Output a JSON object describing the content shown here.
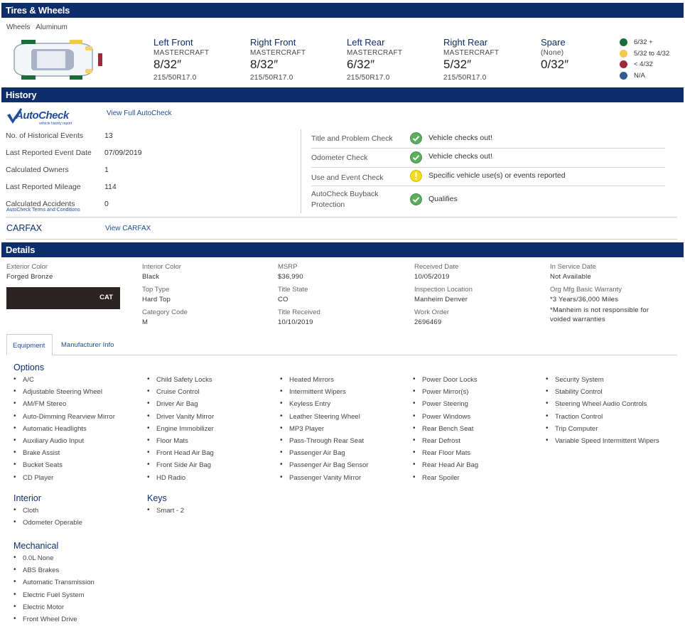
{
  "tires": {
    "header": "Tires & Wheels",
    "wheels_label": "Wheels",
    "wheels_value": "Aluminum",
    "positions": [
      {
        "name": "Left Front",
        "brand": "MASTERCRAFT",
        "depth": "8/32″",
        "size": "215/50R17.0"
      },
      {
        "name": "Right Front",
        "brand": "MASTERCRAFT",
        "depth": "8/32″",
        "size": "215/50R17.0"
      },
      {
        "name": "Left Rear",
        "brand": "MASTERCRAFT",
        "depth": "6/32″",
        "size": "215/50R17.0"
      },
      {
        "name": "Right Rear",
        "brand": "MASTERCRAFT",
        "depth": "5/32″",
        "size": "215/50R17.0"
      },
      {
        "name": "Spare",
        "brand": "(None)",
        "depth": "0/32″",
        "size": ""
      }
    ],
    "legend": [
      {
        "label": "6/32 +",
        "color": "#1c6b3a"
      },
      {
        "label": "5/32 to 4/32",
        "color": "#f2c94c"
      },
      {
        "label": "< 4/32",
        "color": "#9e2a3d"
      },
      {
        "label": "N/A",
        "color": "#2e5d91"
      }
    ]
  },
  "history": {
    "header": "History",
    "autocheck_logo_text": "AutoCheck",
    "autocheck_logo_sub": "vehicle history report",
    "view_autocheck": "View Full AutoCheck",
    "rows": [
      {
        "label": "No. of Historical Events",
        "value": "13"
      },
      {
        "label": "Last Reported Event Date",
        "value": "07/09/2019"
      },
      {
        "label": "Calculated Owners",
        "value": "1"
      },
      {
        "label": "Last Reported Mileage",
        "value": "114"
      },
      {
        "label": "Calculated Accidents",
        "value": "0"
      }
    ],
    "terms_link": "AutoCheck Terms and Conditions",
    "checks": [
      {
        "label": "Title and Problem Check",
        "result": "Vehicle checks out!",
        "status": "ok"
      },
      {
        "label": "Odometer Check",
        "result": "Vehicle checks out!",
        "status": "ok"
      },
      {
        "label": "Use and Event Check",
        "result": "Specific vehicle use(s) or events reported",
        "status": "warn"
      },
      {
        "label": "AutoCheck Buyback Protection",
        "result": "Qualifies",
        "status": "ok"
      }
    ],
    "carfax_label": "CARFAX",
    "view_carfax": "View CARFAX"
  },
  "details": {
    "header": "Details",
    "exterior_color_label": "Exterior Color",
    "exterior_color_value": "Forged Bronze",
    "swatch_text": "CAT",
    "interior_color_label": "Interior Color",
    "interior_color_value": "Black",
    "top_type_label": "Top Type",
    "top_type_value": "Hard Top",
    "category_code_label": "Category Code",
    "category_code_value": "M",
    "msrp_label": "MSRP",
    "msrp_value": "$36,990",
    "title_state_label": "Title State",
    "title_state_value": "CO",
    "title_received_label": "Title Received",
    "title_received_value": "10/10/2019",
    "received_date_label": "Received Date",
    "received_date_value": "10/05/2019",
    "inspection_location_label": "Inspection Location",
    "inspection_location_value": "Manheim Denver",
    "work_order_label": "Work Order",
    "work_order_value": "2696469",
    "in_service_label": "In Service Date",
    "in_service_value": "Not Available",
    "warranty_label": "Org Mfg Basic Warranty",
    "warranty_value": "*3 Years/36,000 Miles",
    "warranty_note": "*Manheim is not responsible for voided warranties"
  },
  "tabs": {
    "equipment": "Equipment",
    "manufacturer": "Manufacturer Info"
  },
  "equipment": {
    "options_heading": "Options",
    "options_cols": [
      [
        "A/C",
        "Adjustable Steering Wheel",
        "AM/FM Stereo",
        "Auto-Dimming Rearview Mirror",
        "Automatic Headlights",
        "Auxiliary Audio Input",
        "Brake Assist",
        "Bucket Seats",
        "CD Player"
      ],
      [
        "Child Safety Locks",
        "Cruise Control",
        "Driver Air Bag",
        "Driver Vanity Mirror",
        "Engine Immobilizer",
        "Floor Mats",
        "Front Head Air Bag",
        "Front Side Air Bag",
        "HD Radio"
      ],
      [
        "Heated Mirrors",
        "Intermittent Wipers",
        "Keyless Entry",
        "Leather Steering Wheel",
        "MP3 Player",
        "Pass-Through Rear Seat",
        "Passenger Air Bag",
        "Passenger Air Bag Sensor",
        "Passenger Vanity Mirror"
      ],
      [
        "Power Door Locks",
        "Power Mirror(s)",
        "Power Steering",
        "Power Windows",
        "Rear Bench Seat",
        "Rear Defrost",
        "Rear Floor Mats",
        "Rear Head Air Bag",
        "Rear Spoiler"
      ],
      [
        "Security System",
        "Stability Control",
        "Steering Wheel Audio Controls",
        "Traction Control",
        "Trip Computer",
        "Variable Speed Intermittent Wipers"
      ]
    ],
    "interior_heading": "Interior",
    "interior_items": [
      "Cloth",
      "Odometer Operable"
    ],
    "keys_heading": "Keys",
    "keys_items": [
      "Smart - 2"
    ],
    "mechanical_heading": "Mechanical",
    "mechanical_items": [
      "0.0L None",
      "ABS Brakes",
      "Automatic Transmission",
      "Electric Fuel System",
      "Electric Motor",
      "Front Wheel Drive"
    ]
  }
}
